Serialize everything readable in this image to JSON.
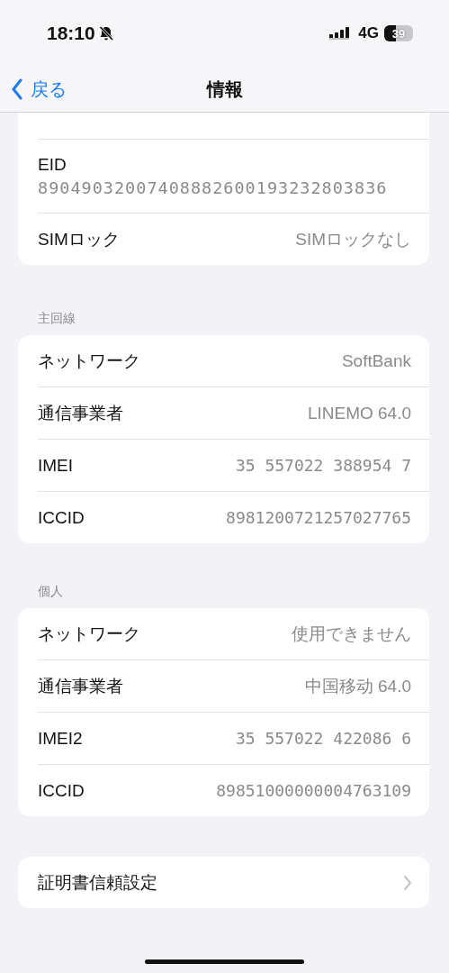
{
  "status_bar": {
    "time": "18:10",
    "silent": true,
    "network": "4G",
    "battery": "39"
  },
  "nav": {
    "back": "戻る",
    "title": "情報"
  },
  "sections": [
    {
      "rows": [
        {
          "kind": "stacked",
          "label": "EID",
          "value": "89049032007408882600193232803836"
        },
        {
          "kind": "value",
          "label": "SIMロック",
          "value": "SIMロックなし"
        }
      ]
    },
    {
      "header": "主回線",
      "rows": [
        {
          "kind": "value",
          "label": "ネットワーク",
          "value": "SoftBank"
        },
        {
          "kind": "value",
          "label": "通信事業者",
          "value": "LINEMO 64.0"
        },
        {
          "kind": "value",
          "label": "IMEI",
          "value": "35 557022 388954 7"
        },
        {
          "kind": "value",
          "label": "ICCID",
          "value": "8981200721257027765"
        }
      ]
    },
    {
      "header": "個人",
      "rows": [
        {
          "kind": "value",
          "label": "ネットワーク",
          "value": "使用できません"
        },
        {
          "kind": "value",
          "label": "通信事業者",
          "value": "中国移动 64.0"
        },
        {
          "kind": "value",
          "label": "IMEI2",
          "value": "35 557022 422086 6"
        },
        {
          "kind": "value",
          "label": "ICCID",
          "value": "89851000000004763109"
        }
      ]
    },
    {
      "rows": [
        {
          "kind": "link",
          "label": "証明書信頼設定"
        }
      ]
    }
  ]
}
